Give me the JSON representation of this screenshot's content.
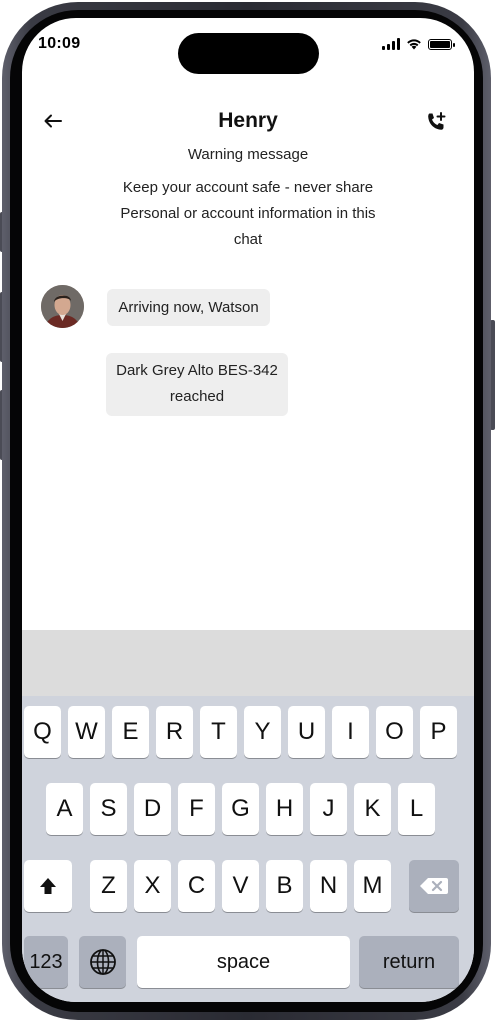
{
  "status_bar": {
    "time": "10:09"
  },
  "header": {
    "contact_name": "Henry"
  },
  "warning": {
    "title": "Warning message",
    "line1": "Keep your account safe - never share",
    "line2": "Personal or account information in this",
    "line3": "chat"
  },
  "messages": [
    {
      "text": "Arriving now, Watson"
    },
    {
      "line1": "Dark Grey Alto BES-342",
      "line2": "reached"
    }
  ],
  "keyboard": {
    "row1": [
      "Q",
      "W",
      "E",
      "R",
      "T",
      "Y",
      "U",
      "I",
      "O",
      "P"
    ],
    "row2": [
      "A",
      "S",
      "D",
      "F",
      "G",
      "H",
      "J",
      "K",
      "L"
    ],
    "row3": [
      "Z",
      "X",
      "C",
      "V",
      "B",
      "N",
      "M"
    ],
    "numbers_label": "123",
    "space_label": "space",
    "return_label": "return"
  },
  "colors": {
    "keyboard_bg": "#cfd3dc",
    "key_bg": "#ffffff",
    "bubble_bg": "#eeeeee"
  }
}
